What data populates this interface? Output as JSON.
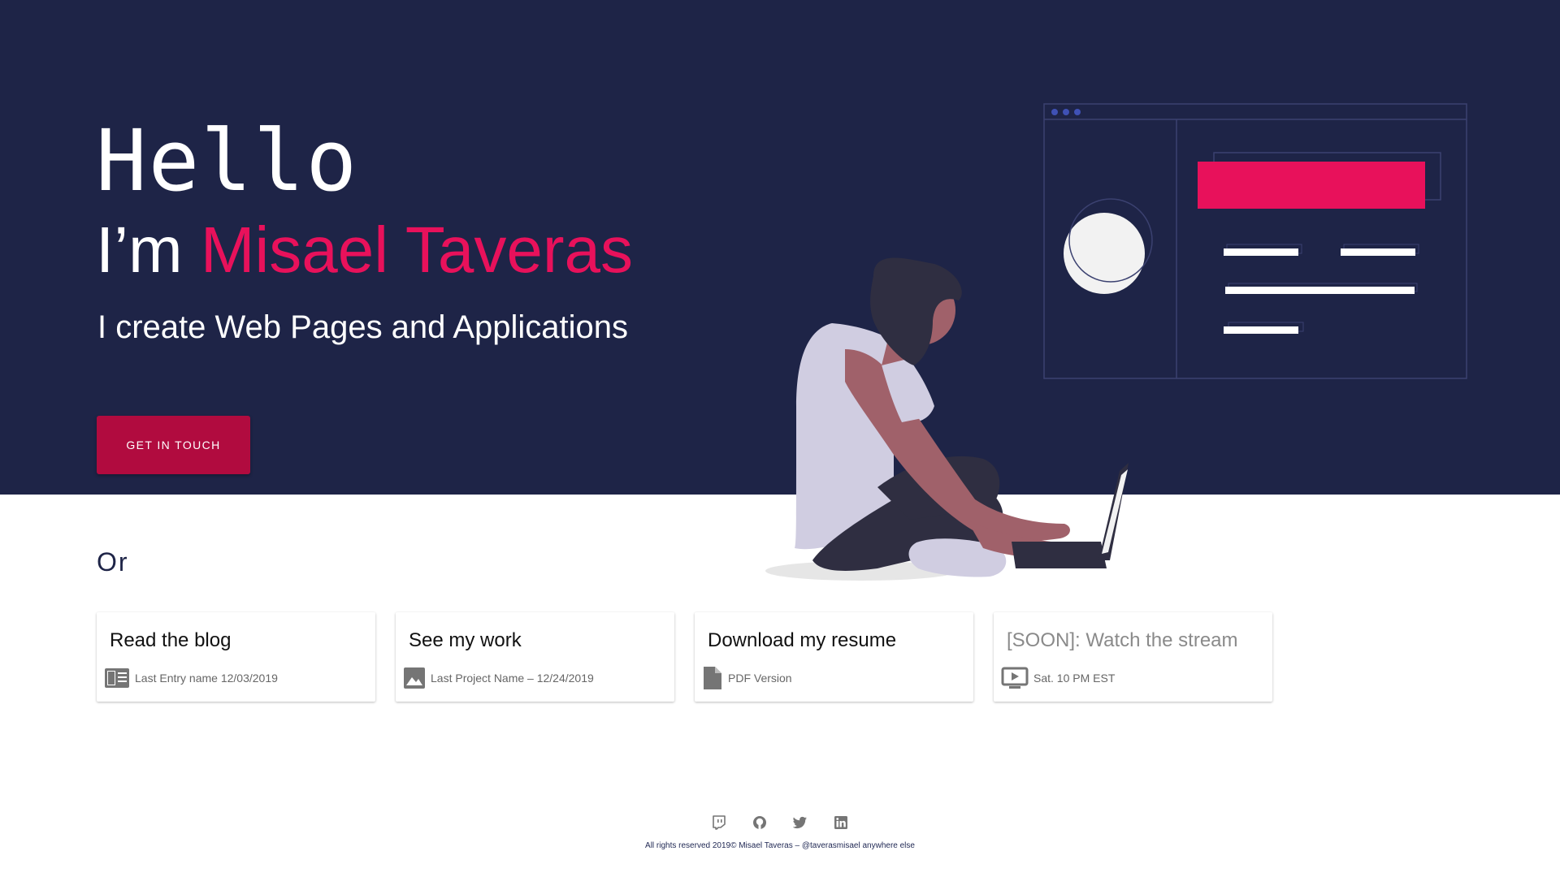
{
  "hero": {
    "greeting": "Hello",
    "intro_prefix": "I’m ",
    "name": "Misael Taveras",
    "tagline": "I create Web Pages and Applications",
    "cta_label": "GET IN TOUCH"
  },
  "or_label": "Or",
  "cards": [
    {
      "title": "Read the blog",
      "meta": "Last Entry name  12/03/2019",
      "icon": "newspaper-icon"
    },
    {
      "title": "See my work",
      "meta": "Last Project Name – 12/24/2019",
      "icon": "image-icon"
    },
    {
      "title": "Download my resume",
      "meta": "PDF Version",
      "icon": "document-icon"
    },
    {
      "title": "[SOON]: Watch the stream",
      "meta": "Sat. 10 PM EST",
      "icon": "live-tv-icon"
    }
  ],
  "footer": {
    "icons": [
      "twitch-icon",
      "github-icon",
      "twitter-icon",
      "linkedin-icon"
    ],
    "copyright": "All rights reserved 2019© Misael Taveras – @taverasmisael anywhere else"
  },
  "colors": {
    "hero_background": "#1e2447",
    "accent": "#e8115b",
    "button": "#b10b3f",
    "icon_gray": "#757575"
  }
}
